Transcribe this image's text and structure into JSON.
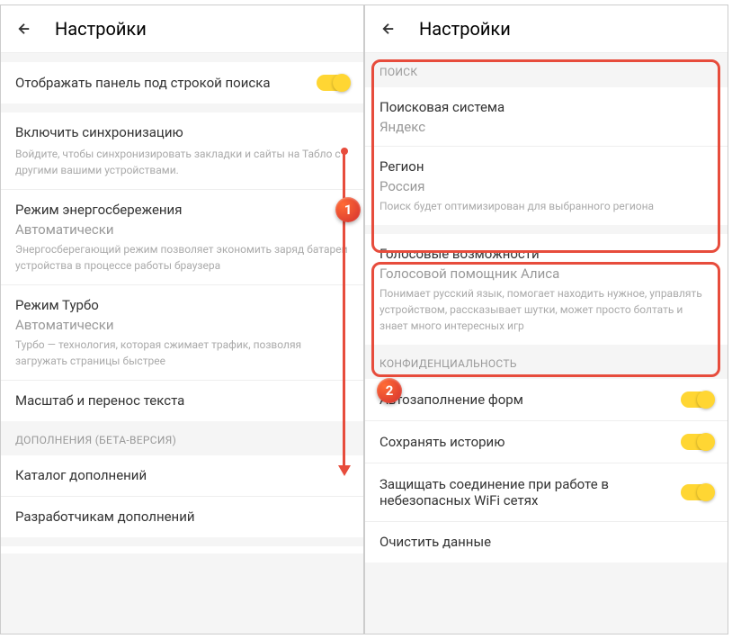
{
  "left": {
    "header": {
      "title": "Настройки"
    },
    "displayPanel": {
      "label": "Отображать панель под строкой поиска"
    },
    "sync": {
      "title": "Включить синхронизацию",
      "desc": "Войдите, чтобы синхронизировать закладки и сайты на Табло с другими вашими устройствами."
    },
    "energy": {
      "title": "Режим энергосбережения",
      "value": "Автоматически",
      "desc": "Энергосберегающий режим позволяет экономить заряд батареи устройства в процессе работы браузера"
    },
    "turbo": {
      "title": "Режим Турбо",
      "value": "Автоматически",
      "desc": "Турбо — технология, которая сжимает трафик, позволяя загружать страницы быстрее"
    },
    "zoom": {
      "title": "Масштаб и перенос текста"
    },
    "extensionsHeader": "ДОПОЛНЕНИЯ (БЕТА-ВЕРСИЯ)",
    "catalog": {
      "title": "Каталог дополнений"
    },
    "developers": {
      "title": "Разработчикам дополнений"
    },
    "marker": "1"
  },
  "right": {
    "header": {
      "title": "Настройки"
    },
    "searchHeader": "ПОИСК",
    "searchEngine": {
      "title": "Поисковая система",
      "value": "Яндекс"
    },
    "region": {
      "title": "Регион",
      "value": "Россия",
      "desc": "Поиск будет оптимизирован для выбранного региона"
    },
    "voice": {
      "title": "Голосовые возможности",
      "value": "Голосовой помощник Алиса",
      "desc": "Понимает русский язык, помогает находить нужное, управлять устройством, рассказывает шутки, может просто болтать и знает много интересных игр"
    },
    "privacyHeader": "КОНФИДЕНЦИАЛЬНОСТЬ",
    "autofill": {
      "label": "Автозаполнение форм"
    },
    "history": {
      "label": "Сохранять историю"
    },
    "wifi": {
      "label": "Защищать соединение при работе в небезопасных WiFi сетях"
    },
    "clear": {
      "title": "Очистить данные"
    },
    "marker": "2"
  }
}
